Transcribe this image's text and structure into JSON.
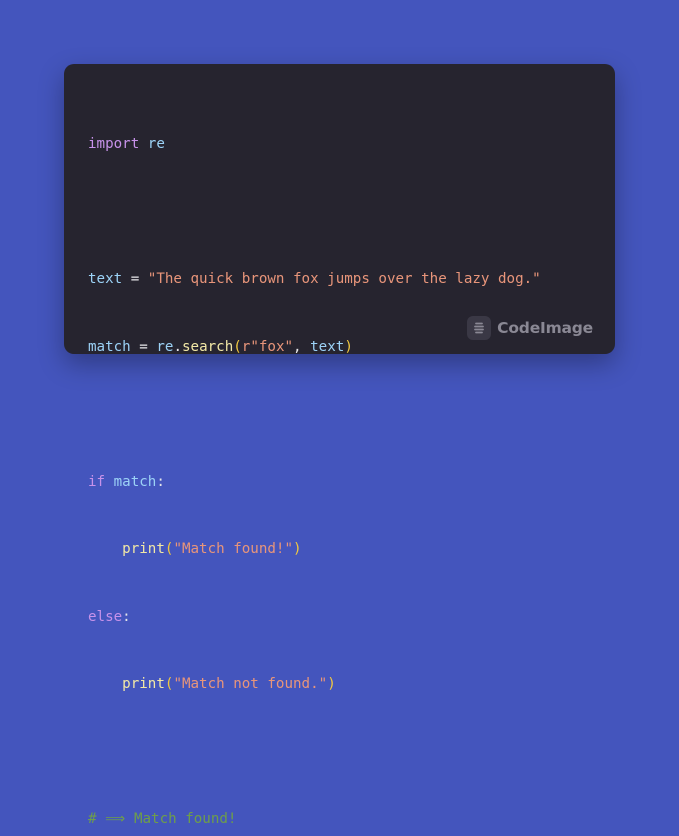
{
  "colors": {
    "background": "#4455bd",
    "window": "#26242f",
    "keyword": "#c792ea",
    "variable": "#9cd2f6",
    "function": "#f2e8a6",
    "string": "#e8957a",
    "bracket": "#f0c840",
    "comment": "#6e9e4a",
    "brand": "#8a8894"
  },
  "code": {
    "line1": {
      "kw": "import",
      "sp": " ",
      "mod": "re"
    },
    "line3": {
      "var": "text",
      "op": " = ",
      "str": "\"The quick brown fox jumps over the lazy dog.\""
    },
    "line4": {
      "var": "match",
      "op": " = ",
      "mod": "re",
      "dot": ".",
      "fn": "search",
      "lp": "(",
      "prefix": "r",
      "str": "\"fox\"",
      "comma": ", ",
      "arg": "text",
      "rp": ")"
    },
    "line6": {
      "kw": "if",
      "sp": " ",
      "var": "match",
      "colon": ":"
    },
    "line7": {
      "indent": "    ",
      "fn": "print",
      "lp": "(",
      "str": "\"Match found!\"",
      "rp": ")"
    },
    "line8": {
      "kw": "else",
      "colon": ":"
    },
    "line9": {
      "indent": "    ",
      "fn": "print",
      "lp": "(",
      "str": "\"Match not found.\"",
      "rp": ")"
    },
    "line11": {
      "comment": "# ⟹ Match found!"
    }
  },
  "brand": {
    "icon": "codeimage-logo-icon",
    "name": "CodeImage"
  }
}
